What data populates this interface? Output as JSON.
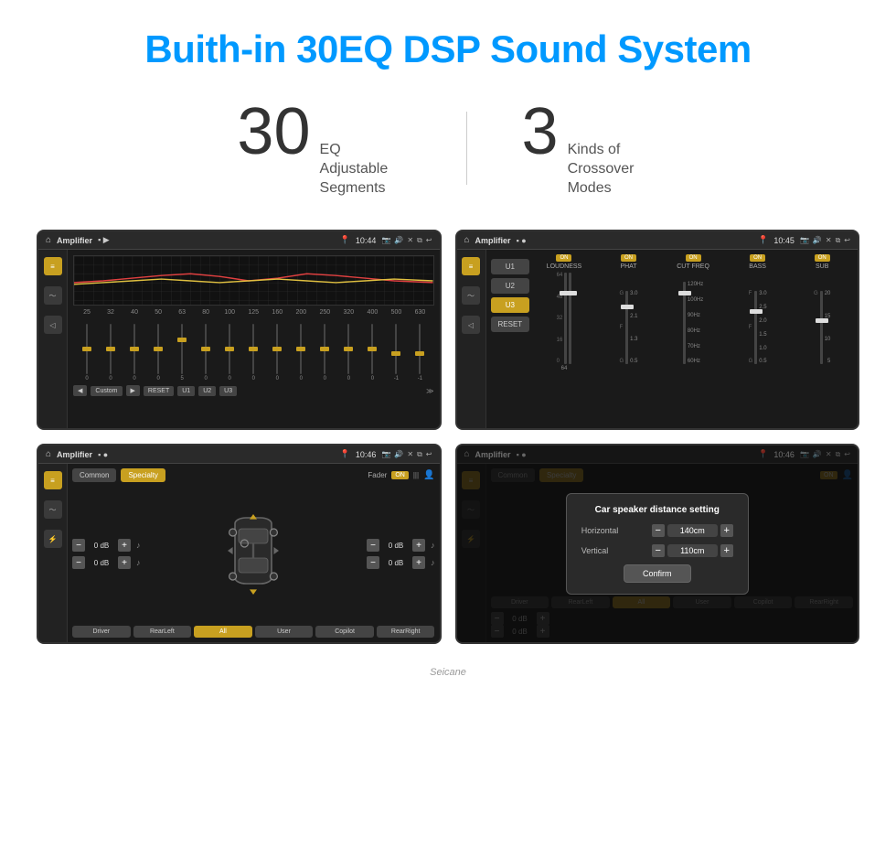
{
  "header": {
    "title": "Buith-in 30EQ DSP Sound System"
  },
  "stats": [
    {
      "number": "30",
      "desc_line1": "EQ Adjustable",
      "desc_line2": "Segments"
    },
    {
      "number": "3",
      "desc_line1": "Kinds of",
      "desc_line2": "Crossover Modes"
    }
  ],
  "screens": [
    {
      "id": "eq-screen",
      "topbar": {
        "title": "Amplifier",
        "time": "10:44"
      },
      "type": "equalizer",
      "eq_labels": [
        "25",
        "32",
        "40",
        "50",
        "63",
        "80",
        "100",
        "125",
        "160",
        "200",
        "250",
        "320",
        "400",
        "500",
        "630"
      ],
      "eq_values": [
        "0",
        "0",
        "0",
        "0",
        "5",
        "0",
        "0",
        "0",
        "0",
        "0",
        "0",
        "0",
        "0",
        "-1",
        "0",
        "-1"
      ],
      "bottom_buttons": [
        "◀",
        "Custom",
        "▶",
        "RESET",
        "U1",
        "U2",
        "U3"
      ]
    },
    {
      "id": "crossover-screen",
      "topbar": {
        "title": "Amplifier",
        "time": "10:45"
      },
      "type": "crossover",
      "presets": [
        "U1",
        "U2",
        "U3"
      ],
      "active_preset": "U3",
      "channels": [
        {
          "name": "LOUDNESS",
          "on": true
        },
        {
          "name": "PHAT",
          "on": true
        },
        {
          "name": "CUT FREQ",
          "on": true
        },
        {
          "name": "BASS",
          "on": true
        },
        {
          "name": "SUB",
          "on": true
        }
      ],
      "reset_label": "RESET"
    },
    {
      "id": "specialty-screen",
      "topbar": {
        "title": "Amplifier",
        "time": "10:46"
      },
      "type": "specialty",
      "tabs": [
        "Common",
        "Specialty"
      ],
      "active_tab": "Specialty",
      "fader_label": "Fader",
      "fader_on": "ON",
      "db_values": [
        "0 dB",
        "0 dB",
        "0 dB",
        "0 dB"
      ],
      "zone_buttons": [
        "Driver",
        "RearLeft",
        "All",
        "User",
        "Copilot",
        "RearRight"
      ]
    },
    {
      "id": "distance-screen",
      "topbar": {
        "title": "Amplifier",
        "time": "10:46"
      },
      "type": "distance-dialog",
      "tabs": [
        "Common",
        "Specialty"
      ],
      "active_tab": "Specialty",
      "dialog": {
        "title": "Car speaker distance setting",
        "horizontal_label": "Horizontal",
        "horizontal_value": "140cm",
        "vertical_label": "Vertical",
        "vertical_value": "110cm",
        "confirm_label": "Confirm"
      },
      "zone_buttons": [
        "Driver",
        "RearLeft",
        "All",
        "User",
        "Copilot",
        "RearRight"
      ],
      "db_values": [
        "0 dB",
        "0 dB"
      ]
    }
  ],
  "watermark": "Seicane"
}
